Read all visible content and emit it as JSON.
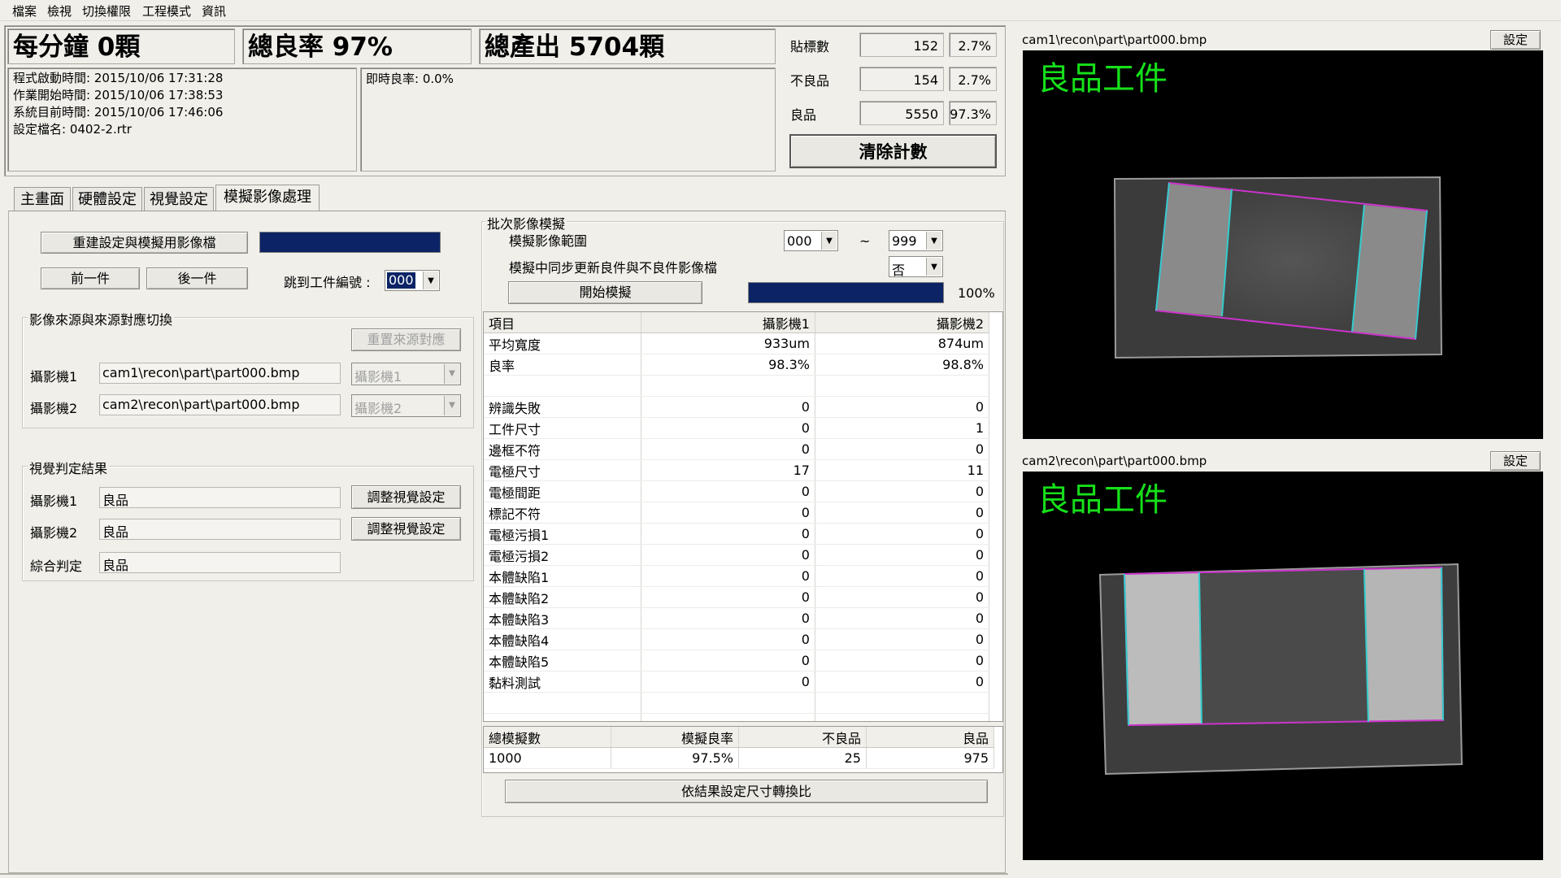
{
  "menu": [
    "檔案",
    "檢視",
    "切換權限",
    "工程模式",
    "資訊"
  ],
  "stats": {
    "per_minute": "每分鐘 0顆",
    "total_yield": "總良率 97%",
    "total_output": "總產出 5704顆"
  },
  "info": {
    "start_time": "程式啟動時間: 2015/10/06 17:31:28",
    "job_start": "作業開始時間: 2015/10/06 17:38:53",
    "current_time": "系統目前時間: 2015/10/06 17:46:06",
    "config_file": "設定檔名: 0402-2.rtr",
    "instant_yield": "即時良率: 0.0%"
  },
  "counters": [
    {
      "label": "貼標數",
      "count": "152",
      "pct": "2.7%"
    },
    {
      "label": "不良品",
      "count": "154",
      "pct": "2.7%"
    },
    {
      "label": "良品",
      "count": "5550",
      "pct": "97.3%"
    }
  ],
  "clear_button": "清除計數",
  "tabs": [
    "主畫面",
    "硬體設定",
    "視覺設定",
    "模擬影像處理"
  ],
  "left": {
    "rebuild_button": "重建設定與模擬用影像檔",
    "prev_button": "前一件",
    "next_button": "後一件",
    "jump_label": "跳到工件編號 :",
    "jump_value": "000",
    "source_group": {
      "title": "影像來源與來源對應切換",
      "reset_button": "重置來源對應",
      "cam1_label": "攝影機1",
      "cam1_path": "cam1\\recon\\part\\part000.bmp",
      "cam1_select": "攝影機1",
      "cam2_label": "攝影機2",
      "cam2_path": "cam2\\recon\\part\\part000.bmp",
      "cam2_select": "攝影機2"
    },
    "result_group": {
      "title": "視覺判定結果",
      "cam1_label": "攝影機1",
      "cam1_result": "良品",
      "cam2_label": "攝影機2",
      "cam2_result": "良品",
      "overall_label": "綜合判定",
      "overall_result": "良品",
      "adjust_button": "調整視覺設定"
    }
  },
  "batch": {
    "title": "批次影像模擬",
    "range_label": "模擬影像範圍",
    "range_from": "000",
    "tilde": "~",
    "range_to": "999",
    "sync_label": "模擬中同步更新良件與不良件影像檔",
    "sync_value": "否",
    "start_button": "開始模擬",
    "progress_text": "100%",
    "progress": 1.0,
    "table_headers": [
      "項目",
      "攝影機1",
      "攝影機2"
    ],
    "rows": [
      [
        "平均寬度",
        "933um",
        "874um"
      ],
      [
        "良率",
        "98.3%",
        "98.8%"
      ],
      [
        "",
        "",
        ""
      ],
      [
        "辨識失敗",
        "0",
        "0"
      ],
      [
        "工件尺寸",
        "0",
        "1"
      ],
      [
        "邊框不符",
        "0",
        "0"
      ],
      [
        "電極尺寸",
        "17",
        "11"
      ],
      [
        "電極間距",
        "0",
        "0"
      ],
      [
        "標記不符",
        "0",
        "0"
      ],
      [
        "電極污損1",
        "0",
        "0"
      ],
      [
        "電極污損2",
        "0",
        "0"
      ],
      [
        "本體缺陷1",
        "0",
        "0"
      ],
      [
        "本體缺陷2",
        "0",
        "0"
      ],
      [
        "本體缺陷3",
        "0",
        "0"
      ],
      [
        "本體缺陷4",
        "0",
        "0"
      ],
      [
        "本體缺陷5",
        "0",
        "0"
      ],
      [
        "黏料測試",
        "0",
        "0"
      ]
    ],
    "summary_headers": [
      "總模擬數",
      "模擬良率",
      "不良品",
      "良品"
    ],
    "summary_values": [
      "1000",
      "97.5%",
      "25",
      "975"
    ],
    "convert_button": "依結果設定尺寸轉換比"
  },
  "cam_views": [
    {
      "path": "cam1\\recon\\part\\part000.bmp",
      "settings": "設定",
      "status": "良品工件"
    },
    {
      "path": "cam2\\recon\\part\\part000.bmp",
      "settings": "設定",
      "status": "良品工件"
    }
  ],
  "colors": {
    "progress": "#0c2465",
    "ok_text": "#16e01a",
    "outline_magenta": "#cc33cc",
    "outline_cyan": "#33cccc"
  }
}
